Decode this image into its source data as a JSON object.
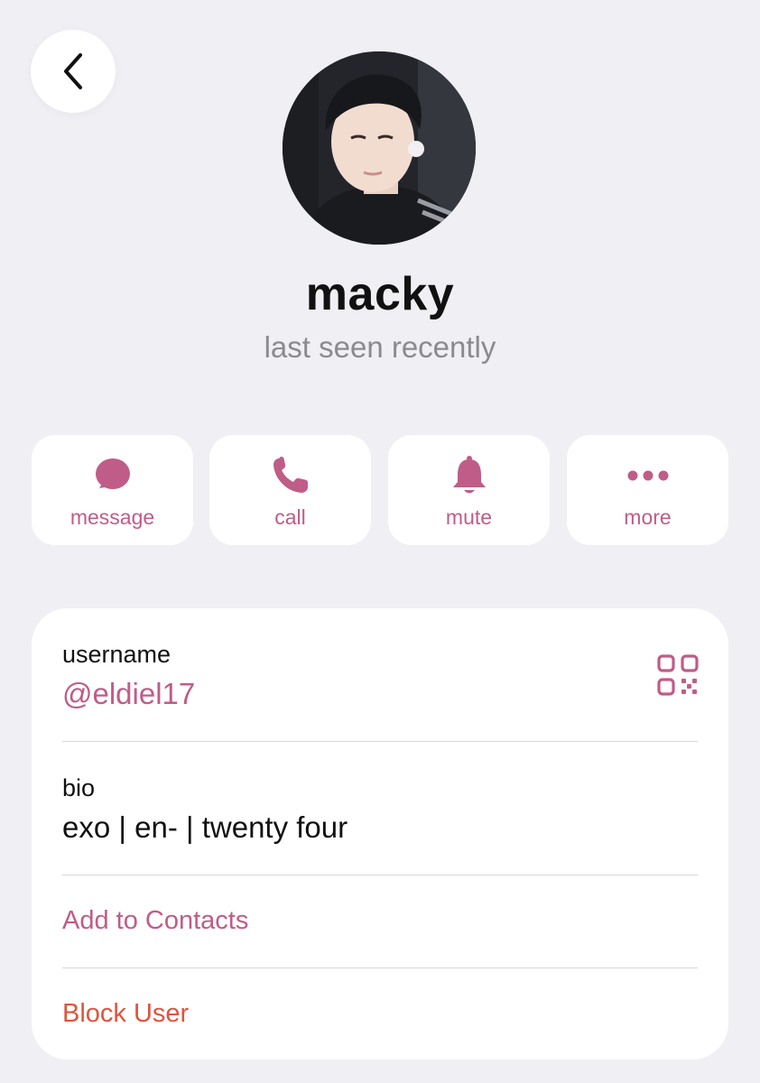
{
  "header": {
    "back_icon": "chevron-left-icon"
  },
  "profile": {
    "name": "macky",
    "status": "last seen recently",
    "avatar_icon": "profile-photo"
  },
  "actions": [
    {
      "label": "message",
      "icon": "message-bubble-icon"
    },
    {
      "label": "call",
      "icon": "phone-icon"
    },
    {
      "label": "mute",
      "icon": "bell-icon"
    },
    {
      "label": "more",
      "icon": "more-dots-icon"
    }
  ],
  "info": {
    "username_label": "username",
    "username_value": "@eldiel17",
    "qr_icon": "qr-code-icon",
    "bio_label": "bio",
    "bio_value": "exo | en- | twenty four",
    "add_contact": "Add to Contacts",
    "block_user": "Block User"
  },
  "colors": {
    "accent": "#c05c88",
    "destructive": "#e0533f",
    "background": "#efeff4",
    "secondary_text": "#8a8a8f"
  }
}
